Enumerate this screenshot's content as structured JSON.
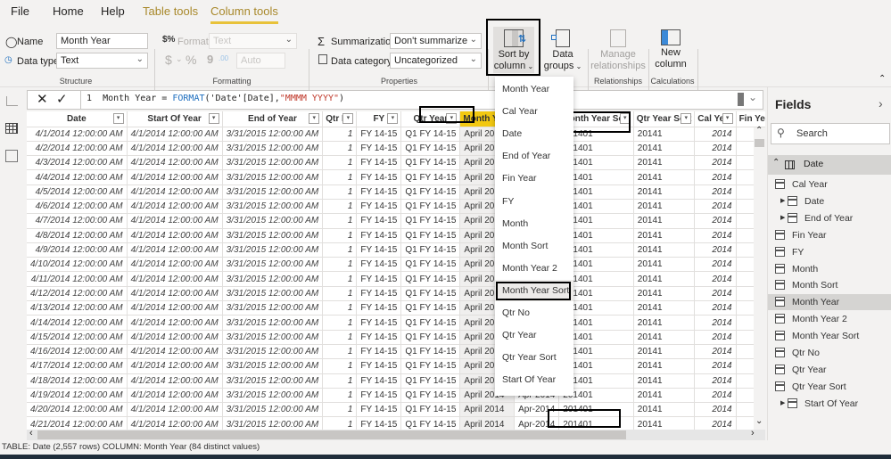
{
  "tabs": [
    {
      "label": "File"
    },
    {
      "label": "Home"
    },
    {
      "label": "Help"
    },
    {
      "label": "Table tools"
    },
    {
      "label": "Column tools"
    }
  ],
  "ribbon": {
    "structure": {
      "name_label": "Name",
      "name_value": "Month Year",
      "datatype_label": "Data type",
      "datatype_value": "Text",
      "group_label": "Structure"
    },
    "formatting": {
      "format_label": "Format",
      "format_value": "Text",
      "currency_symbol": "$",
      "percent_symbol": "%",
      "comma_symbol": "9",
      "decimal_symbol": ".00",
      "auto_value": "Auto",
      "group_label": "Formatting"
    },
    "properties": {
      "summarization_label": "Summarization",
      "summarization_value": "Don't summarize",
      "category_label": "Data category",
      "category_value": "Uncategorized",
      "group_label": "Properties"
    },
    "sort": {
      "line1": "Sort by",
      "line2": "column"
    },
    "groups": {
      "line1": "Data",
      "line2": "groups"
    },
    "relationships": {
      "line1": "Manage",
      "line2": "relationships",
      "group_label": "Relationships"
    },
    "calculations": {
      "line1": "New",
      "line2": "column",
      "group_label": "Calculations"
    }
  },
  "formula": {
    "line_no": "1",
    "prefix": "Month Year = ",
    "fn": "FORMAT",
    "args": "('Date'[Date],",
    "str": "\"MMMM YYYY\"",
    "close": ")"
  },
  "table": {
    "columns": [
      "Date",
      "Start Of Year",
      "End of Year",
      "Qtr No",
      "FY",
      "Qtr Year",
      "Month Year",
      "Mo",
      "Month Year Sort",
      "Qtr Year Sort",
      "Cal Year",
      "Fin Ye"
    ],
    "rows": [
      [
        "4/1/2014 12:00:00 AM",
        "4/1/2014 12:00:00 AM",
        "3/31/2015 12:00:00 AM",
        "1",
        "FY 14-15",
        "Q1 FY 14-15",
        "April 2014",
        "Apr-2014",
        "201401",
        "20141",
        "2014"
      ],
      [
        "4/2/2014 12:00:00 AM",
        "4/1/2014 12:00:00 AM",
        "3/31/2015 12:00:00 AM",
        "1",
        "FY 14-15",
        "Q1 FY 14-15",
        "April 2014",
        "Apr-2014",
        "201401",
        "20141",
        "2014"
      ],
      [
        "4/3/2014 12:00:00 AM",
        "4/1/2014 12:00:00 AM",
        "3/31/2015 12:00:00 AM",
        "1",
        "FY 14-15",
        "Q1 FY 14-15",
        "April 2014",
        "Apr-2014",
        "201401",
        "20141",
        "2014"
      ],
      [
        "4/4/2014 12:00:00 AM",
        "4/1/2014 12:00:00 AM",
        "3/31/2015 12:00:00 AM",
        "1",
        "FY 14-15",
        "Q1 FY 14-15",
        "April 2014",
        "Apr-2014",
        "201401",
        "20141",
        "2014"
      ],
      [
        "4/5/2014 12:00:00 AM",
        "4/1/2014 12:00:00 AM",
        "3/31/2015 12:00:00 AM",
        "1",
        "FY 14-15",
        "Q1 FY 14-15",
        "April 2014",
        "Apr-2014",
        "201401",
        "20141",
        "2014"
      ],
      [
        "4/6/2014 12:00:00 AM",
        "4/1/2014 12:00:00 AM",
        "3/31/2015 12:00:00 AM",
        "1",
        "FY 14-15",
        "Q1 FY 14-15",
        "April 2014",
        "Apr-2014",
        "201401",
        "20141",
        "2014"
      ],
      [
        "4/7/2014 12:00:00 AM",
        "4/1/2014 12:00:00 AM",
        "3/31/2015 12:00:00 AM",
        "1",
        "FY 14-15",
        "Q1 FY 14-15",
        "April 2014",
        "Apr-2014",
        "201401",
        "20141",
        "2014"
      ],
      [
        "4/8/2014 12:00:00 AM",
        "4/1/2014 12:00:00 AM",
        "3/31/2015 12:00:00 AM",
        "1",
        "FY 14-15",
        "Q1 FY 14-15",
        "April 2014",
        "Apr-2014",
        "201401",
        "20141",
        "2014"
      ],
      [
        "4/9/2014 12:00:00 AM",
        "4/1/2014 12:00:00 AM",
        "3/31/2015 12:00:00 AM",
        "1",
        "FY 14-15",
        "Q1 FY 14-15",
        "April 2014",
        "Apr-2014",
        "201401",
        "20141",
        "2014"
      ],
      [
        "4/10/2014 12:00:00 AM",
        "4/1/2014 12:00:00 AM",
        "3/31/2015 12:00:00 AM",
        "1",
        "FY 14-15",
        "Q1 FY 14-15",
        "April 2014",
        "Apr-2014",
        "201401",
        "20141",
        "2014"
      ],
      [
        "4/11/2014 12:00:00 AM",
        "4/1/2014 12:00:00 AM",
        "3/31/2015 12:00:00 AM",
        "1",
        "FY 14-15",
        "Q1 FY 14-15",
        "April 2014",
        "Apr-2014",
        "201401",
        "20141",
        "2014"
      ],
      [
        "4/12/2014 12:00:00 AM",
        "4/1/2014 12:00:00 AM",
        "3/31/2015 12:00:00 AM",
        "1",
        "FY 14-15",
        "Q1 FY 14-15",
        "April 2014",
        "Apr-2014",
        "201401",
        "20141",
        "2014"
      ],
      [
        "4/13/2014 12:00:00 AM",
        "4/1/2014 12:00:00 AM",
        "3/31/2015 12:00:00 AM",
        "1",
        "FY 14-15",
        "Q1 FY 14-15",
        "April 2014",
        "Apr-2014",
        "201401",
        "20141",
        "2014"
      ],
      [
        "4/14/2014 12:00:00 AM",
        "4/1/2014 12:00:00 AM",
        "3/31/2015 12:00:00 AM",
        "1",
        "FY 14-15",
        "Q1 FY 14-15",
        "April 2014",
        "Apr-2014",
        "201401",
        "20141",
        "2014"
      ],
      [
        "4/15/2014 12:00:00 AM",
        "4/1/2014 12:00:00 AM",
        "3/31/2015 12:00:00 AM",
        "1",
        "FY 14-15",
        "Q1 FY 14-15",
        "April 2014",
        "Apr-2014",
        "201401",
        "20141",
        "2014"
      ],
      [
        "4/16/2014 12:00:00 AM",
        "4/1/2014 12:00:00 AM",
        "3/31/2015 12:00:00 AM",
        "1",
        "FY 14-15",
        "Q1 FY 14-15",
        "April 2014",
        "Apr-2014",
        "201401",
        "20141",
        "2014"
      ],
      [
        "4/17/2014 12:00:00 AM",
        "4/1/2014 12:00:00 AM",
        "3/31/2015 12:00:00 AM",
        "1",
        "FY 14-15",
        "Q1 FY 14-15",
        "April 2014",
        "Apr-2014",
        "201401",
        "20141",
        "2014"
      ],
      [
        "4/18/2014 12:00:00 AM",
        "4/1/2014 12:00:00 AM",
        "3/31/2015 12:00:00 AM",
        "1",
        "FY 14-15",
        "Q1 FY 14-15",
        "April 2014",
        "Apr-2014",
        "201401",
        "20141",
        "2014"
      ],
      [
        "4/19/2014 12:00:00 AM",
        "4/1/2014 12:00:00 AM",
        "3/31/2015 12:00:00 AM",
        "1",
        "FY 14-15",
        "Q1 FY 14-15",
        "April 2014",
        "Apr-2014",
        "201401",
        "20141",
        "2014"
      ],
      [
        "4/20/2014 12:00:00 AM",
        "4/1/2014 12:00:00 AM",
        "3/31/2015 12:00:00 AM",
        "1",
        "FY 14-15",
        "Q1 FY 14-15",
        "April 2014",
        "Apr-2014",
        "201401",
        "20141",
        "2014"
      ],
      [
        "4/21/2014 12:00:00 AM",
        "4/1/2014 12:00:00 AM",
        "3/31/2015 12:00:00 AM",
        "1",
        "FY 14-15",
        "Q1 FY 14-15",
        "April 2014",
        "Apr-2014",
        "201401",
        "20141",
        "2014"
      ]
    ]
  },
  "sort_menu": {
    "items": [
      "Month Year",
      "Cal Year",
      "Date",
      "End of Year",
      "Fin Year",
      "FY",
      "Month",
      "Month Sort",
      "Month Year 2",
      "Month Year Sort",
      "Qtr No",
      "Qtr Year",
      "Qtr Year Sort",
      "Start Of Year"
    ],
    "highlighted": "Month Year Sort"
  },
  "fields_pane": {
    "title": "Fields",
    "search_placeholder": "Search",
    "table_name": "Date",
    "items": [
      {
        "label": "Cal Year",
        "expandable": false
      },
      {
        "label": "Date",
        "expandable": true
      },
      {
        "label": "End of Year",
        "expandable": true
      },
      {
        "label": "Fin Year",
        "expandable": false
      },
      {
        "label": "FY",
        "expandable": false
      },
      {
        "label": "Month",
        "expandable": false
      },
      {
        "label": "Month Sort",
        "expandable": false
      },
      {
        "label": "Month Year",
        "expandable": false
      },
      {
        "label": "Month Year 2",
        "expandable": false
      },
      {
        "label": "Month Year Sort",
        "expandable": false
      },
      {
        "label": "Qtr No",
        "expandable": false
      },
      {
        "label": "Qtr Year",
        "expandable": false
      },
      {
        "label": "Qtr Year Sort",
        "expandable": false
      },
      {
        "label": "Start Of Year",
        "expandable": true
      }
    ],
    "selected": "Month Year"
  },
  "status": {
    "text": "TABLE: Date (2,557 rows) COLUMN: Month Year (84 distinct values)"
  },
  "colors": {
    "accent": "#f2c811",
    "tab_active": "#a8882a"
  }
}
